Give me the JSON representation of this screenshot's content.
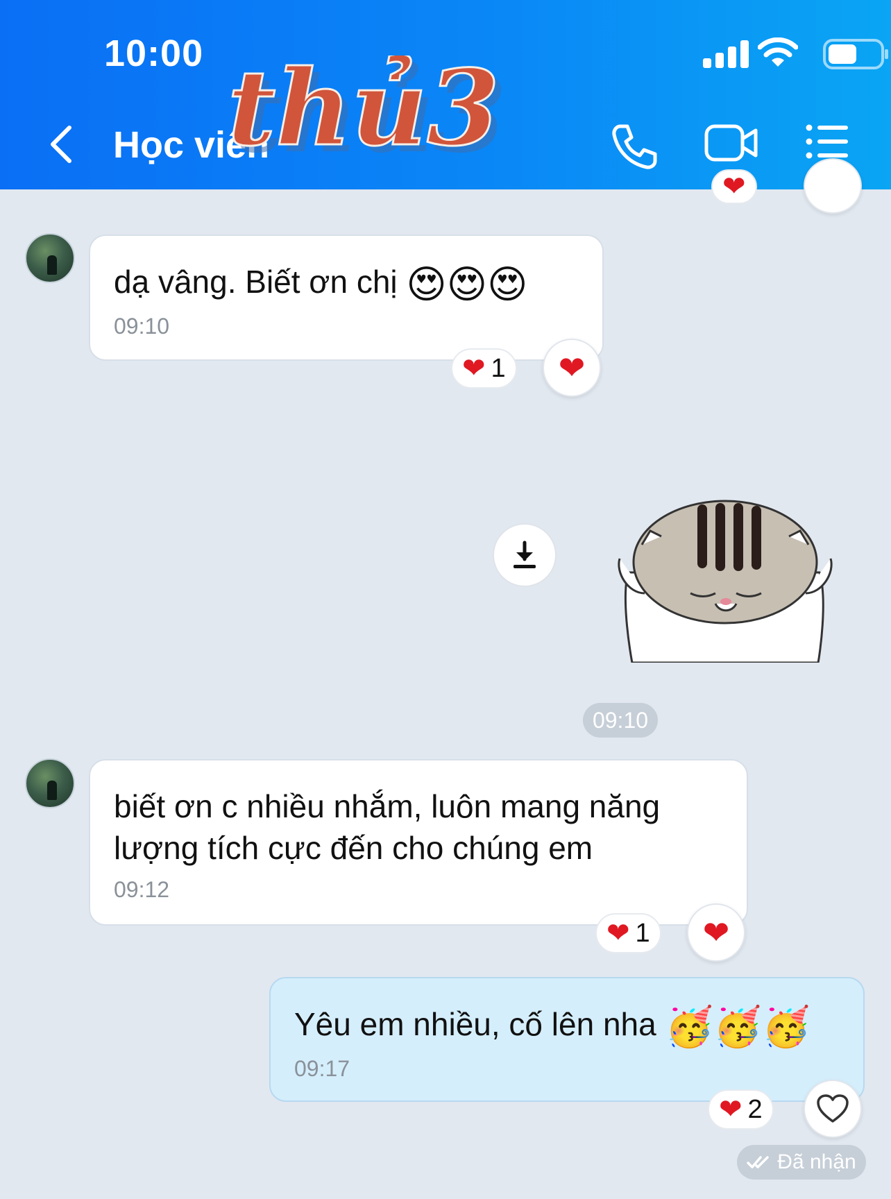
{
  "status_bar": {
    "time": "10:00",
    "icons": [
      "signal-icon",
      "wifi-icon",
      "battery-icon"
    ]
  },
  "header": {
    "title": "Học viên",
    "watermark_text": "thủ3",
    "actions": [
      "phone-call-icon",
      "video-call-icon",
      "menu-icon"
    ],
    "accent_color": "#0a87f6"
  },
  "messages": [
    {
      "sender": "other",
      "text": "dạ vâng. Biết ơn chị",
      "emojis": "😍😍😍",
      "time": "09:10",
      "reaction_count": "1",
      "reaction_icon": "heart-icon"
    },
    {
      "sender": "me",
      "type": "sticker",
      "sticker": "cat-sticker"
    },
    {
      "sender": "other",
      "text": "biết ơn c nhiều nhắm, luôn mang năng lượng tích cực đến cho chúng em",
      "time": "09:12",
      "reaction_count": "1",
      "reaction_icon": "heart-icon"
    },
    {
      "sender": "me",
      "text": "Yêu em nhiều, cố lên nha",
      "emojis": "🥳🥳🥳",
      "time": "09:17",
      "reaction_count": "2",
      "reaction_icon": "heart-outline-icon"
    }
  ],
  "time_separator": "09:10",
  "delivery_status": "Đã nhận",
  "colors": {
    "background": "#e2e8f0",
    "my_bubble": "#d5eefc",
    "heart": "#e01822"
  }
}
